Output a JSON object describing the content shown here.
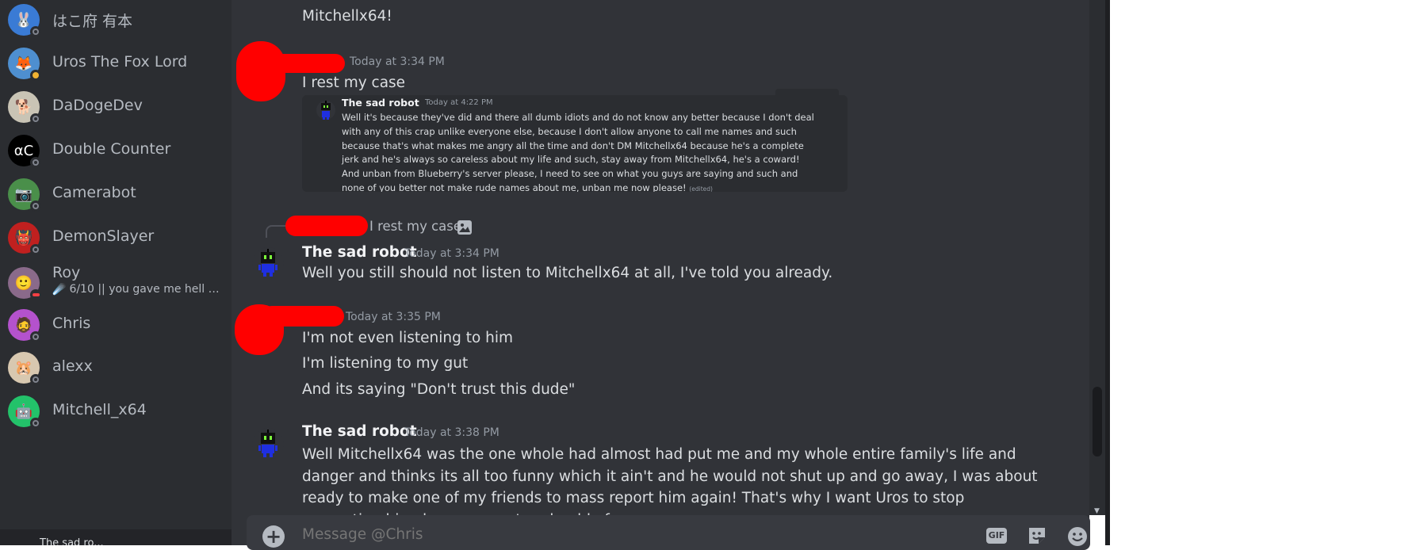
{
  "members": [
    {
      "name": "はこ府 有本",
      "status": "offline",
      "avatar_color": "#3a7bd5",
      "glyph": "🐰"
    },
    {
      "name": "Uros The Fox Lord",
      "status": "idle",
      "avatar_color": "#4e8fd0",
      "glyph": "🦊"
    },
    {
      "name": "DaDogeDev",
      "status": "offline",
      "avatar_color": "#c9c4b5",
      "glyph": "🐕"
    },
    {
      "name": "Double Counter",
      "status": "offline",
      "avatar_color": "#000000",
      "glyph": "αC"
    },
    {
      "name": "Camerabot",
      "status": "offline",
      "avatar_color": "#4a8f4a",
      "glyph": "📷"
    },
    {
      "name": "DemonSlayer",
      "status": "offline",
      "avatar_color": "#c0201f",
      "glyph": "👹"
    },
    {
      "name": "Roy",
      "status": "dnd",
      "avatar_color": "#8a6a8a",
      "glyph": "🙂",
      "activity_emoji": "☄️",
      "activity": "6/10 || you gave me hell o..."
    },
    {
      "name": "Chris",
      "status": "offline",
      "avatar_color": "#b452cd",
      "glyph": "🧔"
    },
    {
      "name": "alexx",
      "status": "offline",
      "avatar_color": "#d8c8b0",
      "glyph": "🐹"
    },
    {
      "name": "Mitchell_x64",
      "status": "offline",
      "avatar_color": "#23c26a",
      "glyph": "🤖"
    }
  ],
  "current_user_label": "The sad ro...",
  "messages": {
    "m0_text": "Mitchellx64!",
    "m1_ts": "Today at 3:34 PM",
    "m1_text": "I rest my case",
    "embed": {
      "name": "The sad robot",
      "ts": "Today at 4:22 PM",
      "body": "Well it's because they've did and there all dumb idiots and do not know any better because I don't deal with any of this crap unlike everyone else, because I don't allow anyone to call me names and such because that's what makes me angry all the time and don't DM Mitchellx64 because he's a complete jerk and he's always so careless about my life and such, stay away from Mitchellx64, he's a coward! And unban from Blueberry's server please, I need to see on what you guys are saying and such and none of you better not make rude names about me, unban me now please!",
      "edited": "(edited)"
    },
    "reply_text": "I rest my case",
    "m2_name": "The sad robot",
    "m2_ts": "Today at 3:34 PM",
    "m2_text": "Well you still should not listen to Mitchellx64 at all, I've told you already.",
    "m3_ts": "Today at 3:35 PM",
    "m3_lines": [
      "I'm not even listening to him",
      "I'm listening to my gut",
      "And its saying \"Don't trust this dude\""
    ],
    "m4_name": "The sad robot",
    "m4_ts": "Today at 3:38 PM",
    "m4_text": "Well Mitchellx64 was the one whole had almost had put me and my whole entire family's life and danger and thinks its all too funny which it ain't and he would not shut up and go away, I was about ready to make one of my friends to mass report him again! That's why I want Uros to stop supporting him, because you've should of"
  },
  "composer": {
    "placeholder": "Message @Chris",
    "gif_label": "GIF"
  },
  "colors": {
    "sidebar_bg": "#2b2d31",
    "chat_bg": "#313338",
    "redaction": "#ff0000",
    "bot_blue": "#1f2fe0",
    "bot_eyes": "#7cff3a"
  }
}
